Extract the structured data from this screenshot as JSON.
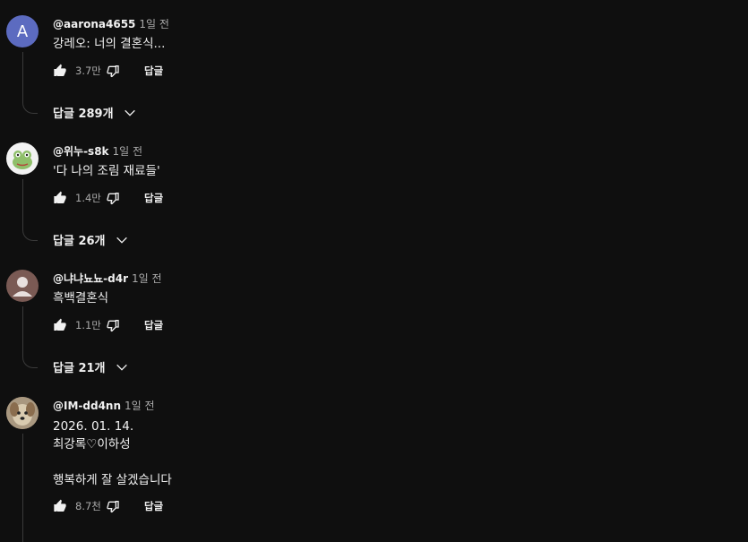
{
  "comments": [
    {
      "author": "@aarona4655",
      "time": "1일 전",
      "avatar_letter": "A",
      "text": "강레오: 너의 결혼식...",
      "likes": "3.7만",
      "reply_label": "답글",
      "replies_label": "답글 289개"
    },
    {
      "author": "@위누-s8k",
      "time": "1일 전",
      "text": "'다 나의 조림 재료들'",
      "likes": "1.4만",
      "reply_label": "답글",
      "replies_label": "답글 26개"
    },
    {
      "author": "@냐냐뇨뇨-d4r",
      "time": "1일 전",
      "text": "흑백결혼식",
      "likes": "1.1만",
      "reply_label": "답글",
      "replies_label": "답글 21개"
    },
    {
      "author": "@IM-dd4nn",
      "time": "1일 전",
      "text": "2026. 01. 14.\n최강록♡이하성\n\n행복하게 잘 살겠습니다",
      "likes": "8.7천",
      "reply_label": "답글"
    }
  ],
  "colors": {
    "background": "#0f0f0f",
    "text": "#f1f1f1",
    "secondary": "#aaaaaa",
    "avatar_letter_bg": "#5c6bc0"
  },
  "icons": {
    "like": "thumbs-up-icon",
    "dislike": "thumbs-down-icon",
    "expand": "chevron-down-icon"
  }
}
